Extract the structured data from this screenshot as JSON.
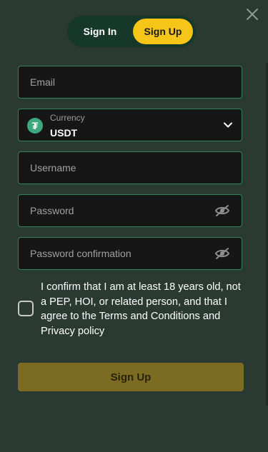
{
  "auth_tabs": {
    "signin_label": "Sign In",
    "signup_label": "Sign Up",
    "active": "Sign Up"
  },
  "close_icon": "close-icon",
  "form": {
    "email": {
      "placeholder": "Email",
      "value": ""
    },
    "currency": {
      "label": "Currency",
      "value": "USDT",
      "icon": "tether-icon",
      "icon_glyph": "₮"
    },
    "username": {
      "placeholder": "Username",
      "value": ""
    },
    "password": {
      "placeholder": "Password",
      "value": "",
      "toggle_icon": "eye-off-icon"
    },
    "password_confirmation": {
      "placeholder": "Password confirmation",
      "value": "",
      "toggle_icon": "eye-off-icon"
    },
    "consent": {
      "checked": false,
      "text": "I confirm that I am at least 18 years old, not a PEP, HOI, or related person, and that I agree to the Terms and Conditions and Privacy policy"
    },
    "submit_label": "Sign Up"
  },
  "colors": {
    "background": "#2a3a32",
    "accent": "#f5c518",
    "field_border": "#2f8558",
    "submit_disabled": "#7c6b22"
  }
}
